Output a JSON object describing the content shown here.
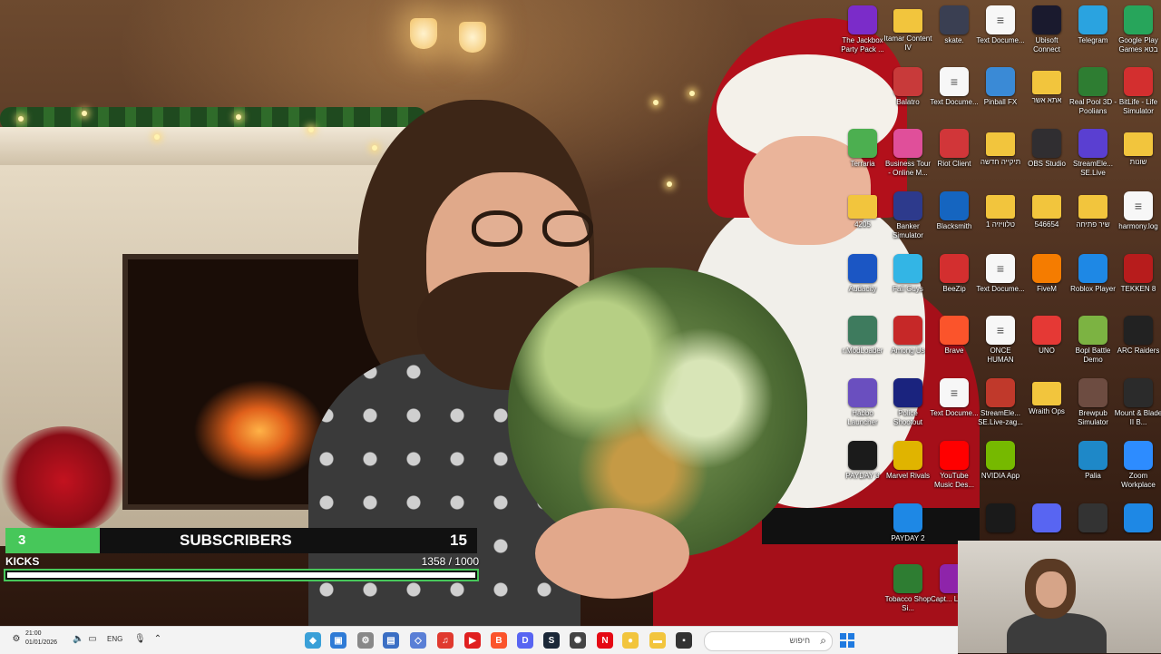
{
  "overlay": {
    "subscribers_count": "3",
    "subscribers_label": "SUBSCRIBERS",
    "subscribers_goal": "15",
    "subscribers_progress": 0.2,
    "kicks_label": "KICKS",
    "kicks_count": "1358 / 1000",
    "kicks_progress": 1.0
  },
  "taskbar": {
    "time": "21:00",
    "date": "01/01/2026",
    "tray_text": "ENG",
    "search_placeholder": "חיפוש"
  },
  "desktop_icons": [
    {
      "label": "The Jackbox Party Pack ...",
      "icon": "jackbox-icon",
      "color": "#7b2cc9"
    },
    {
      "label": "Itamar Content IV",
      "icon": "folder-icon",
      "color": "#f2c53d"
    },
    {
      "label": "skate.",
      "icon": "skate-icon",
      "color": "#3a3f52"
    },
    {
      "label": "Text Docume...",
      "icon": "text-document-icon",
      "color": "#f7f7f7"
    },
    {
      "label": "Ubisoft Connect",
      "icon": "ubisoft-icon",
      "color": "#1a1a2e"
    },
    {
      "label": "Telegram",
      "icon": "telegram-icon",
      "color": "#2aa3e0"
    },
    {
      "label": "Google Play Games בטא",
      "icon": "google-play-games-icon",
      "color": "#27a55b"
    },
    {
      "label": "Balatro",
      "icon": "balatro-icon",
      "color": "#c83a3a"
    },
    {
      "label": "Text Docume...",
      "icon": "text-document-icon",
      "color": "#f7f7f7"
    },
    {
      "label": "Pinball FX",
      "icon": "pinball-icon",
      "color": "#3a8ad6"
    },
    {
      "label": "אתא אשר",
      "icon": "folder-icon",
      "color": "#f2c53d"
    },
    {
      "label": "Real Pool 3D - Poolians",
      "icon": "pool-icon",
      "color": "#2e7d32"
    },
    {
      "label": "BitLife - Life Simulator",
      "icon": "bitlife-icon",
      "color": "#d32f2f"
    },
    {
      "label": "Terraria",
      "icon": "terraria-icon",
      "color": "#4caf50"
    },
    {
      "label": "Business Tour - Online M...",
      "icon": "business-tour-icon",
      "color": "#e04f9a"
    },
    {
      "label": "Riot Client",
      "icon": "riot-icon",
      "color": "#d13639"
    },
    {
      "label": "תיקייה חדשה",
      "icon": "folder-icon",
      "color": "#f2c53d"
    },
    {
      "label": "OBS Studio",
      "icon": "obs-icon",
      "color": "#302e31"
    },
    {
      "label": "StreamEle... SE.Live",
      "icon": "streamelements-icon",
      "color": "#5a3fd1"
    },
    {
      "label": "שונות",
      "icon": "folder-icon",
      "color": "#f2c53d"
    },
    {
      "label": "4205",
      "icon": "folder-icon",
      "color": "#f2c53d"
    },
    {
      "label": "Banker Simulator",
      "icon": "banker-icon",
      "color": "#2d3a8c"
    },
    {
      "label": "Blacksmith",
      "icon": "blacksmith-icon",
      "color": "#1565c0"
    },
    {
      "label": "1 טלוויזיה",
      "icon": "folder-icon",
      "color": "#f2c53d"
    },
    {
      "label": "546654",
      "icon": "folder-icon",
      "color": "#f2c53d"
    },
    {
      "label": "שיר פתיחה",
      "icon": "folder-icon",
      "color": "#f2c53d"
    },
    {
      "label": "harmony.log",
      "icon": "text-document-icon",
      "color": "#f7f7f7"
    },
    {
      "label": "Audacity",
      "icon": "audacity-icon",
      "color": "#1b56c4"
    },
    {
      "label": "Fall Guys",
      "icon": "fall-guys-icon",
      "color": "#33b5e5"
    },
    {
      "label": "BeeZip",
      "icon": "beezip-icon",
      "color": "#d32f2f"
    },
    {
      "label": "Text Docume...",
      "icon": "text-document-icon",
      "color": "#f7f7f7"
    },
    {
      "label": "FiveM",
      "icon": "fivem-icon",
      "color": "#f57c00"
    },
    {
      "label": "Roblox Player",
      "icon": "roblox-icon",
      "color": "#1e88e5"
    },
    {
      "label": "TEKKEN 8",
      "icon": "tekken-icon",
      "color": "#b71c1c"
    },
    {
      "label": "r.ModLoader",
      "icon": "modloader-icon",
      "color": "#3e7b5e"
    },
    {
      "label": "Among Us",
      "icon": "among-us-icon",
      "color": "#c62828"
    },
    {
      "label": "Brave",
      "icon": "brave-icon",
      "color": "#fb542b"
    },
    {
      "label": "ONCE HUMAN",
      "icon": "once-human-icon",
      "color": "#f7f7f7"
    },
    {
      "label": "UNO",
      "icon": "uno-icon",
      "color": "#e53935"
    },
    {
      "label": "Bopl Battle Demo",
      "icon": "bopl-battle-icon",
      "color": "#7cb342"
    },
    {
      "label": "ARC Raiders",
      "icon": "arc-raiders-icon",
      "color": "#222222"
    },
    {
      "label": "Habbo Launcher",
      "icon": "habbo-icon",
      "color": "#6a4fbf"
    },
    {
      "label": "Police Shootout",
      "icon": "police-shootout-icon",
      "color": "#1a237e"
    },
    {
      "label": "Text Docume...",
      "icon": "text-document-icon",
      "color": "#f7f7f7"
    },
    {
      "label": "StreamEle... SE.Live-zag...",
      "icon": "streamelements-icon",
      "color": "#c0392b"
    },
    {
      "label": "Wraith Ops",
      "icon": "folder-icon",
      "color": "#f2c53d"
    },
    {
      "label": "Brewpub Simulator",
      "icon": "brewpub-icon",
      "color": "#6d4c41"
    },
    {
      "label": "Mount & Blade II B...",
      "icon": "mount-blade-icon",
      "color": "#2b2b2b"
    },
    {
      "label": "PAYDAY 3",
      "icon": "payday3-icon",
      "color": "#1b1b1b"
    },
    {
      "label": "Marvel Rivals",
      "icon": "marvel-rivals-icon",
      "color": "#e0b400"
    },
    {
      "label": "YouTube Music Des...",
      "icon": "youtube-music-icon",
      "color": "#ff0000"
    },
    {
      "label": "NVIDIA App",
      "icon": "nvidia-icon",
      "color": "#76b900"
    },
    {
      "label": "Palia",
      "icon": "palia-icon",
      "color": "#1e88c8"
    },
    {
      "label": "Zoom Workplace",
      "icon": "zoom-icon",
      "color": "#2d8cff"
    },
    {
      "label": "PAYDAY 2",
      "icon": "payday2-icon",
      "color": "#1e88e5"
    },
    {
      "label": "",
      "icon": "2k-icon",
      "color": "#1a1a1a"
    },
    {
      "label": "",
      "icon": "discord-icon",
      "color": "#5865f2"
    },
    {
      "label": "",
      "icon": "game-icon",
      "color": "#333333"
    },
    {
      "label": "",
      "icon": "app-icon",
      "color": "#1e88e5"
    },
    {
      "label": "Tobacco Shop Si...",
      "icon": "tobacco-shop-icon",
      "color": "#2e7d32"
    },
    {
      "label": "Capt... Laser...",
      "icon": "captain-laser-icon",
      "color": "#8e24aa"
    }
  ]
}
